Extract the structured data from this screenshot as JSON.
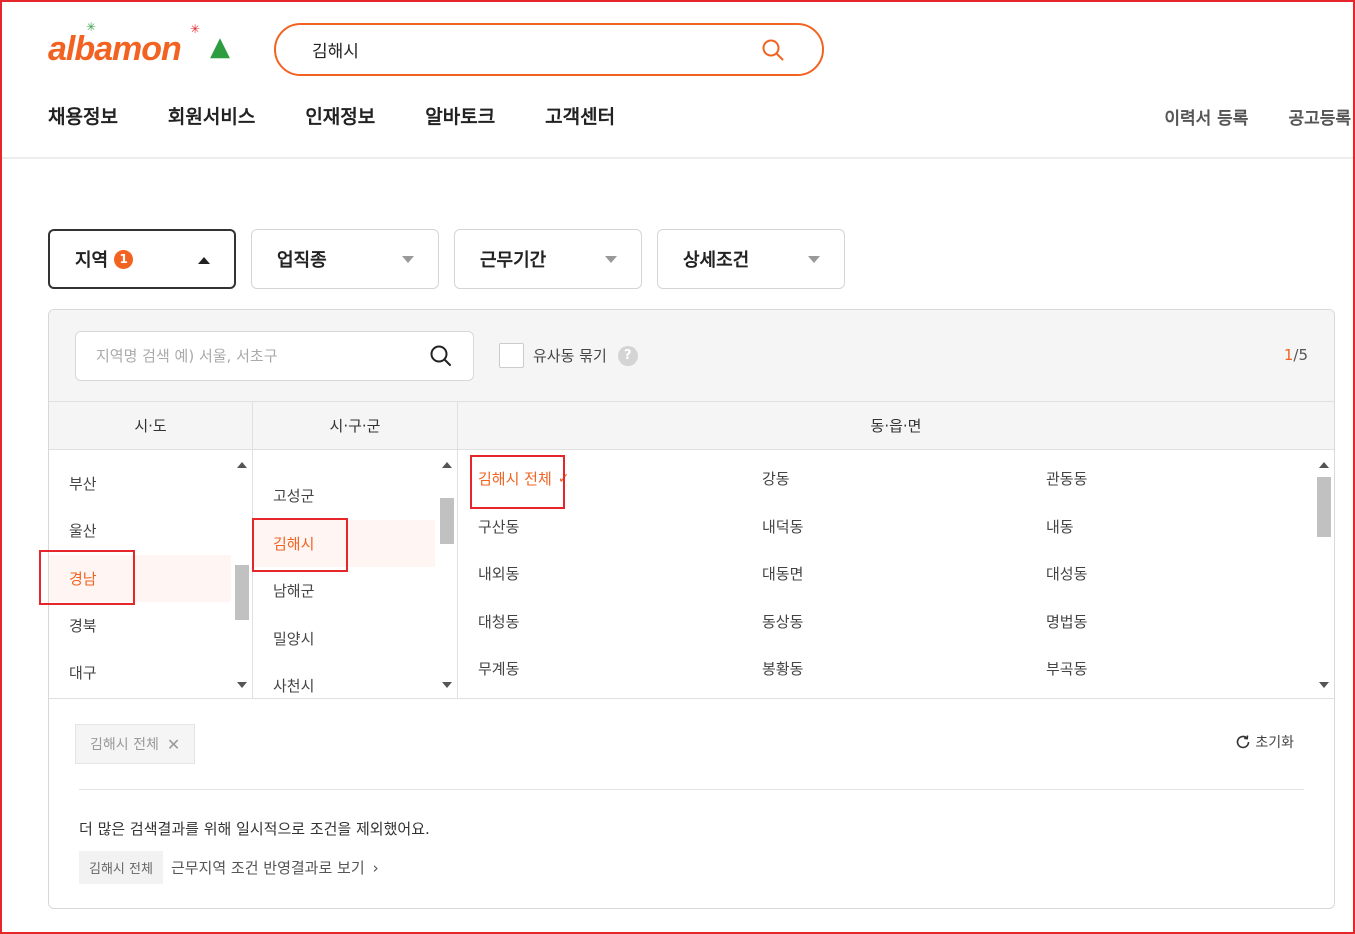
{
  "header": {
    "logo_text": "albamon",
    "search_value": "김해시",
    "nav": [
      "채용정보",
      "회원서비스",
      "인재정보",
      "알바토크",
      "고객센터"
    ],
    "nav_right": [
      "이력서 등록",
      "공고등록"
    ]
  },
  "filters": {
    "region": {
      "label": "지역",
      "badge": "1"
    },
    "job": {
      "label": "업직종"
    },
    "period": {
      "label": "근무기간"
    },
    "detail": {
      "label": "상세조건"
    }
  },
  "panel": {
    "search_placeholder": "지역명 검색 예) 서울, 서초구",
    "similar_label": "유사동 묶기",
    "help": "?",
    "count_current": "1",
    "count_total": "/5",
    "col_sido": "시·도",
    "col_sigungu": "시·구·군",
    "col_dong": "동·읍·면",
    "sido": [
      "부산",
      "울산",
      "경남",
      "경북",
      "대구"
    ],
    "sigungu": [
      "고성군",
      "김해시",
      "남해군",
      "밀양시",
      "사천시"
    ],
    "dong": [
      "김해시 전체",
      "강동",
      "관동동",
      "구산동",
      "내덕동",
      "내동",
      "내외동",
      "대동면",
      "대성동",
      "대청동",
      "동상동",
      "명법동",
      "무계동",
      "봉황동",
      "부곡동"
    ],
    "selected_tag": "김해시 전체",
    "reset_label": "초기화",
    "notice": "더 많은 검색결과를 위해 일시적으로 조건을 제외했어요.",
    "note_tag": "김해시 전체",
    "note_link": "근무지역 조건 반영결과로 보기"
  },
  "colors": {
    "accent": "#f26322",
    "annotation": "#e5262a"
  }
}
